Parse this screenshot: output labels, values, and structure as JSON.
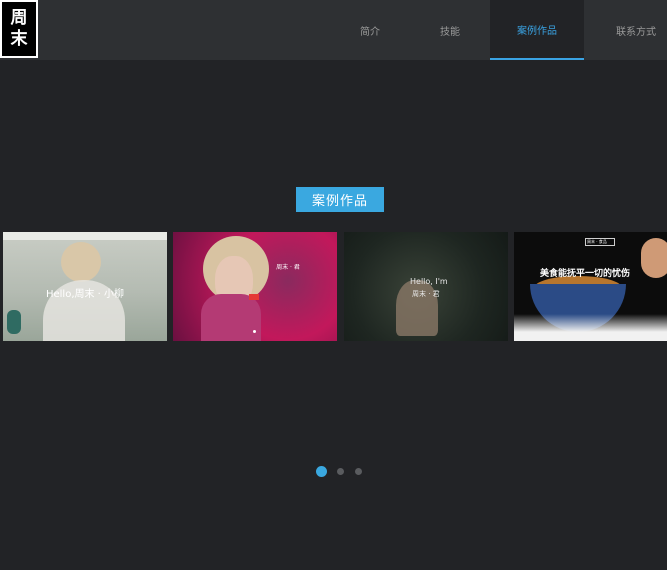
{
  "logo": {
    "line1": "周",
    "line2": "末"
  },
  "nav": {
    "items": [
      {
        "label": "简介"
      },
      {
        "label": "技能"
      },
      {
        "label": "案例作品",
        "active": true
      },
      {
        "label": "联系方式"
      }
    ]
  },
  "section": {
    "title": "案例作品"
  },
  "cards": [
    {
      "title": "Hello,周末 · 小柳"
    },
    {
      "title": "周末 · 君"
    },
    {
      "title_line1": "Hello, I'm",
      "title_line2": "周末 · 君"
    },
    {
      "badge": "周末 · 食品",
      "title": "美食能抚平一切的忧伤"
    }
  ],
  "carousel": {
    "pages": 3,
    "current": 1
  },
  "colors": {
    "accent": "#3aa8e0",
    "nav_bg": "#2e3033",
    "page_bg": "#222326"
  }
}
